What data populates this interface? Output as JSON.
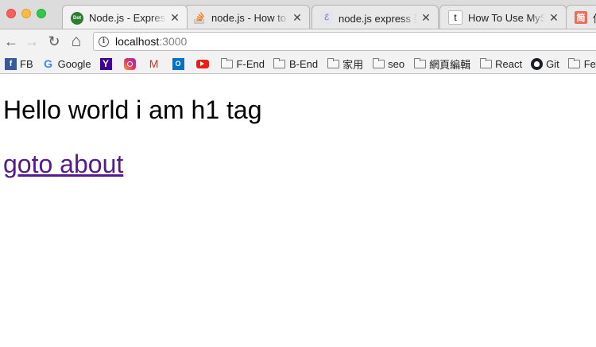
{
  "tabs": [
    {
      "title": "Node.js - Express",
      "favicon": "Dot",
      "favicon_color": "#2e7d32",
      "active": true
    },
    {
      "title": "node.js - How to g",
      "favicon": "stack",
      "favicon_color": "#f48024",
      "active": false
    },
    {
      "title": "node.js express 架",
      "favicon": "doc",
      "favicon_color": "#9e9e9e",
      "active": false
    },
    {
      "title": "How To Use MySQ",
      "favicon": "t",
      "favicon_color": "#000000",
      "active": false
    },
    {
      "title": "使",
      "favicon": "简",
      "favicon_color": "#ea6f5a",
      "active": false
    }
  ],
  "toolbar": {
    "url_host": "localhost",
    "url_port": ":3000",
    "back_icon": "←",
    "forward_icon": "→",
    "reload_icon": "↻",
    "home_icon": "⌂"
  },
  "bookmarks": [
    {
      "label": "FB",
      "icon": "facebook-icon"
    },
    {
      "label": "Google",
      "icon": "google-icon"
    },
    {
      "label": "",
      "icon": "yahoo-icon"
    },
    {
      "label": "",
      "icon": "instagram-icon"
    },
    {
      "label": "",
      "icon": "gmail-icon"
    },
    {
      "label": "",
      "icon": "outlook-icon"
    },
    {
      "label": "",
      "icon": "youtube-icon"
    },
    {
      "label": "F-End",
      "icon": "folder-icon"
    },
    {
      "label": "B-End",
      "icon": "folder-icon"
    },
    {
      "label": "家用",
      "icon": "folder-icon"
    },
    {
      "label": "seo",
      "icon": "folder-icon"
    },
    {
      "label": "網頁編輯",
      "icon": "folder-icon"
    },
    {
      "label": "React",
      "icon": "folder-icon"
    },
    {
      "label": "Git",
      "icon": "github-icon"
    },
    {
      "label": "Fev",
      "icon": "folder-icon"
    }
  ],
  "page": {
    "heading": "Hello world i am h1 tag",
    "link_text": "goto about"
  },
  "colors": {
    "link_visited": "#551a8b",
    "tabstrip_bg": "#dcdcdc",
    "toolbar_bg": "#f2f2f2"
  }
}
